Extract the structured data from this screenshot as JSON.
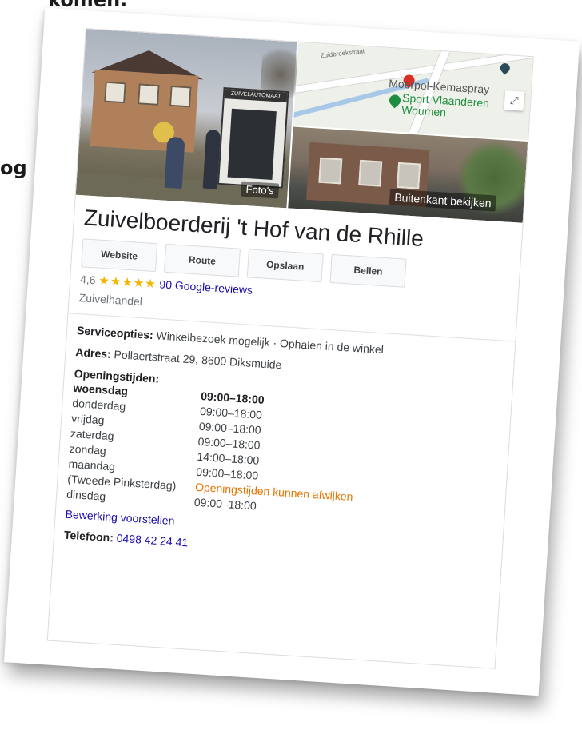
{
  "background_text": {
    "top": "komen.",
    "left": "og"
  },
  "images": {
    "photos_label": "Foto's",
    "outside_label": "Buitenkant bekijken",
    "kiosk_sign": "ZUIVELAUTOMAAT",
    "map_street": "Zuidbroekstraat",
    "map_place_1": "Moerpol-Kemaspray",
    "map_place_2": "Sport Vlaanderen",
    "map_place_3": "Woumen"
  },
  "business": {
    "name": "Zuivelboerderij 't Hof van de Rhille",
    "rating": "4,6",
    "stars": "★★★★★",
    "reviews_link": "90 Google-reviews",
    "category": "Zuivelhandel"
  },
  "actions": [
    "Website",
    "Route",
    "Opslaan",
    "Bellen"
  ],
  "details": {
    "service_label": "Serviceopties:",
    "service_value": "Winkelbezoek mogelijk · Ophalen in de winkel",
    "address_label": "Adres:",
    "address_value": "Pollaertstraat 29, 8600 Diksmuide",
    "hours_label": "Openingstijden:"
  },
  "hours": [
    {
      "day": "woensdag",
      "time": "09:00–18:00",
      "today": true
    },
    {
      "day": "donderdag",
      "time": "09:00–18:00"
    },
    {
      "day": "vrijdag",
      "time": "09:00–18:00"
    },
    {
      "day": "zaterdag",
      "time": "09:00–18:00"
    },
    {
      "day": "zondag",
      "time": "14:00–18:00"
    },
    {
      "day": "maandag",
      "time": "09:00–18:00"
    },
    {
      "day": "(Tweede Pinksterdag)",
      "time": "Openingstijden kunnen afwijken",
      "note": true
    },
    {
      "day": "dinsdag",
      "time": "09:00–18:00"
    }
  ],
  "edit_link": "Bewerking voorstellen",
  "phone": {
    "label": "Telefoon:",
    "number": "0498 42 24 41"
  },
  "colors": {
    "link": "#1a0dab",
    "star": "#f4b400",
    "note": "#e37400",
    "pin_red": "#d93025",
    "pin_green": "#1e8e3e"
  }
}
